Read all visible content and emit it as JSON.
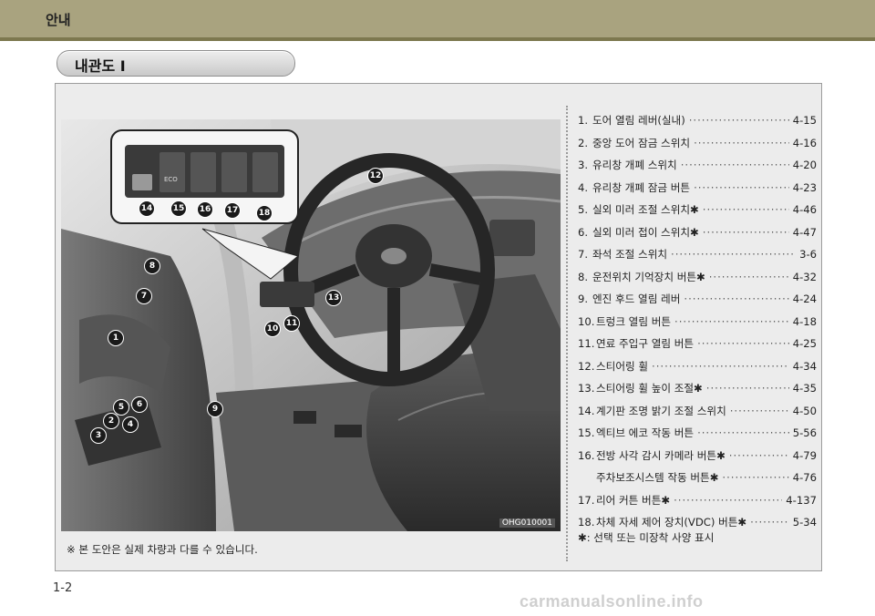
{
  "header": {
    "title": "안내"
  },
  "section": {
    "title": "내관도 Ⅰ"
  },
  "figure": {
    "image_code": "OHG010001",
    "note": "※ 본 도안은 실제 차량과 다를 수 있습니다."
  },
  "callouts": [
    "1",
    "2",
    "3",
    "4",
    "5",
    "6",
    "7",
    "8",
    "9",
    "10",
    "11",
    "12",
    "13",
    "14",
    "15",
    "16",
    "17",
    "18"
  ],
  "toc": [
    {
      "num": "1.",
      "label": "도어 열림 레버(실내)",
      "page": "4-15"
    },
    {
      "num": "2.",
      "label": "중앙 도어 잠금 스위치",
      "page": "4-16"
    },
    {
      "num": "3.",
      "label": "유리창 개폐 스위치",
      "page": "4-20"
    },
    {
      "num": "4.",
      "label": "유리창 개폐 잠금 버튼",
      "page": "4-23"
    },
    {
      "num": "5.",
      "label": "실외 미러 조절 스위치✱",
      "page": "4-46"
    },
    {
      "num": "6.",
      "label": "실외 미러 접이 스위치✱",
      "page": "4-47"
    },
    {
      "num": "7.",
      "label": "좌석 조절 스위치",
      "page": "3-6"
    },
    {
      "num": "8.",
      "label": "운전위치 기억장치 버튼✱",
      "page": "4-32"
    },
    {
      "num": "9.",
      "label": "엔진 후드 열림 레버",
      "page": "4-24"
    },
    {
      "num": "10.",
      "label": "트렁크 열림 버튼",
      "page": "4-18"
    },
    {
      "num": "11.",
      "label": "연료 주입구 열림 버튼",
      "page": "4-25"
    },
    {
      "num": "12.",
      "label": "스티어링 휠",
      "page": "4-34"
    },
    {
      "num": "13.",
      "label": "스티어링 휠 높이 조절✱",
      "page": "4-35"
    },
    {
      "num": "14.",
      "label": "계기판 조명 밝기 조절 스위치",
      "page": "4-50"
    },
    {
      "num": "15.",
      "label": "엑티브 에코 작동 버튼",
      "page": "5-56"
    },
    {
      "num": "16.",
      "label": "전방 사각 감시 카메라 버튼✱",
      "page": "4-79"
    },
    {
      "num": "",
      "label": "주차보조시스템 작동 버튼✱",
      "page": "4-76"
    },
    {
      "num": "17.",
      "label": "리어 커튼 버튼✱",
      "page": "4-137"
    },
    {
      "num": "18.",
      "label": "차체 자세 제어 장치(VDC) 버튼✱",
      "page": "5-34"
    }
  ],
  "legend": "✱: 선택 또는 미장착 사양 표시",
  "footer": {
    "page_number": "1-2",
    "watermark": "carmanualsonline.info"
  },
  "colors": {
    "header_bar": "#a9a37f",
    "panel": "#ececec",
    "callout": "#1a1a1a"
  }
}
